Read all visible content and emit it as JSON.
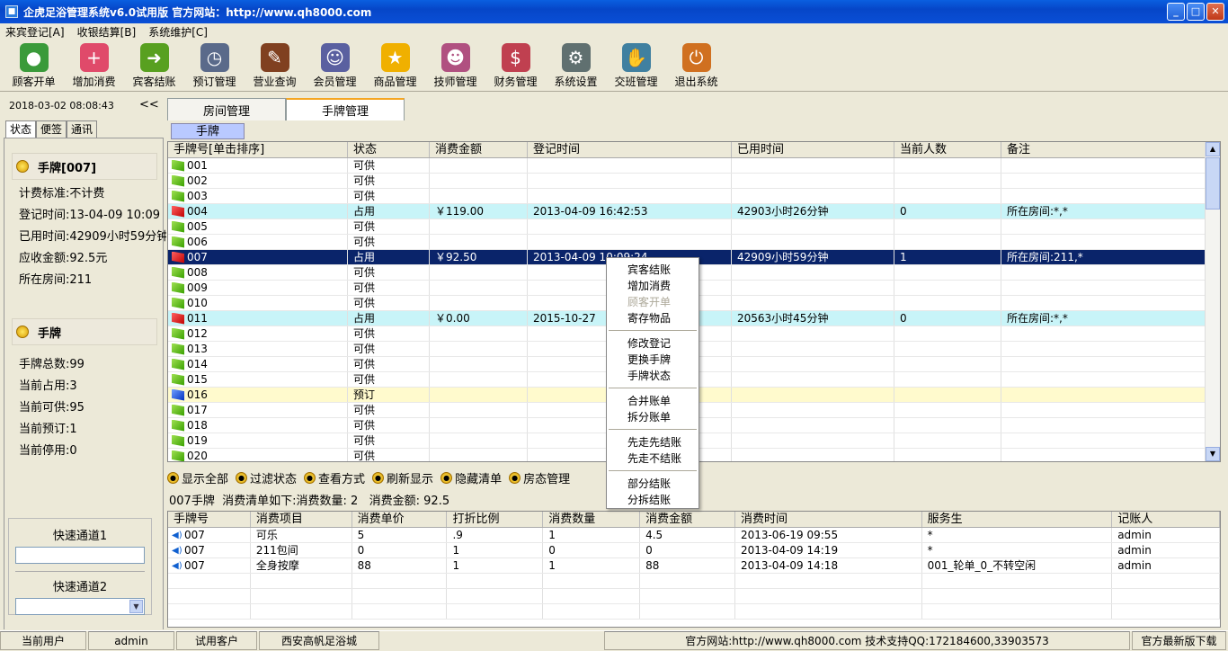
{
  "window": {
    "title": "企虎足浴管理系统v6.0试用版 官方网站：http://www.qh8000.com"
  },
  "menu": [
    "来宾登记[A]",
    "收银结算[B]",
    "系统维护[C]"
  ],
  "toolbar": [
    {
      "label": "顾客开单",
      "icon": "customer-icon",
      "color": "#3a9a3a"
    },
    {
      "label": "增加消费",
      "icon": "add-icon",
      "color": "#e04a6a"
    },
    {
      "label": "宾客结账",
      "icon": "checkout-icon",
      "color": "#58a020"
    },
    {
      "label": "预订管理",
      "icon": "clock-icon",
      "color": "#5a6a8a"
    },
    {
      "label": "营业查询",
      "icon": "query-icon",
      "color": "#804020"
    },
    {
      "label": "会员管理",
      "icon": "members-icon",
      "color": "#5a60a0"
    },
    {
      "label": "商品管理",
      "icon": "star-icon",
      "color": "#f0b000"
    },
    {
      "label": "技师管理",
      "icon": "staff-icon",
      "color": "#b05080"
    },
    {
      "label": "财务管理",
      "icon": "finance-icon",
      "color": "#c04050"
    },
    {
      "label": "系统设置",
      "icon": "settings-icon",
      "color": "#607070"
    },
    {
      "label": "交班管理",
      "icon": "handshake-icon",
      "color": "#4080a0"
    },
    {
      "label": "退出系统",
      "icon": "exit-icon",
      "color": "#d07020"
    }
  ],
  "left": {
    "datetime": "2018-03-02 08:08:43",
    "collapse": "<<",
    "tabs": [
      "状态",
      "便签",
      "通讯"
    ],
    "card_head": "手牌[007]",
    "card_info": [
      "计费标准:不计费",
      "登记时间:13-04-09 10:09",
      "已用时间:42909小时59分钟",
      "应收金额:92.5元",
      "所在房间:211"
    ],
    "stat_head": "手牌",
    "stat_info": [
      "手牌总数:99",
      "当前占用:3",
      "当前可供:95",
      "当前预订:1",
      "当前停用:0"
    ],
    "quick1": "快速通道1",
    "quick2": "快速通道2"
  },
  "tabs": [
    "房间管理",
    "手牌管理"
  ],
  "subtab": "手牌",
  "grid": {
    "headers": [
      "手牌号[单击排序]",
      "状态",
      "消费金额",
      "登记时间",
      "已用时间",
      "当前人数",
      "备注"
    ],
    "rows": [
      {
        "no": "001",
        "status": "可供",
        "amount": "",
        "time": "",
        "used": "",
        "people": "",
        "note": "",
        "type": "free"
      },
      {
        "no": "002",
        "status": "可供",
        "amount": "",
        "time": "",
        "used": "",
        "people": "",
        "note": "",
        "type": "free"
      },
      {
        "no": "003",
        "status": "可供",
        "amount": "",
        "time": "",
        "used": "",
        "people": "",
        "note": "",
        "type": "free"
      },
      {
        "no": "004",
        "status": "占用",
        "amount": "￥119.00",
        "time": "2013-04-09 16:42:53",
        "used": "42903小时26分钟",
        "people": "0",
        "note": "所在房间:*,*",
        "type": "occ"
      },
      {
        "no": "005",
        "status": "可供",
        "amount": "",
        "time": "",
        "used": "",
        "people": "",
        "note": "",
        "type": "free"
      },
      {
        "no": "006",
        "status": "可供",
        "amount": "",
        "time": "",
        "used": "",
        "people": "",
        "note": "",
        "type": "free"
      },
      {
        "no": "007",
        "status": "占用",
        "amount": "￥92.50",
        "time": "2013-04-09 10:09:24",
        "used": "42909小时59分钟",
        "people": "1",
        "note": "所在房间:211,*",
        "type": "sel"
      },
      {
        "no": "008",
        "status": "可供",
        "amount": "",
        "time": "",
        "used": "",
        "people": "",
        "note": "",
        "type": "free"
      },
      {
        "no": "009",
        "status": "可供",
        "amount": "",
        "time": "",
        "used": "",
        "people": "",
        "note": "",
        "type": "free"
      },
      {
        "no": "010",
        "status": "可供",
        "amount": "",
        "time": "",
        "used": "",
        "people": "",
        "note": "",
        "type": "free"
      },
      {
        "no": "011",
        "status": "占用",
        "amount": "￥0.00",
        "time": "2015-10-27",
        "used": "20563小时45分钟",
        "people": "0",
        "note": "所在房间:*,*",
        "type": "occ"
      },
      {
        "no": "012",
        "status": "可供",
        "amount": "",
        "time": "",
        "used": "",
        "people": "",
        "note": "",
        "type": "free"
      },
      {
        "no": "013",
        "status": "可供",
        "amount": "",
        "time": "",
        "used": "",
        "people": "",
        "note": "",
        "type": "free"
      },
      {
        "no": "014",
        "status": "可供",
        "amount": "",
        "time": "",
        "used": "",
        "people": "",
        "note": "",
        "type": "free"
      },
      {
        "no": "015",
        "status": "可供",
        "amount": "",
        "time": "",
        "used": "",
        "people": "",
        "note": "",
        "type": "free"
      },
      {
        "no": "016",
        "status": "预订",
        "amount": "",
        "time": "",
        "used": "",
        "people": "",
        "note": "",
        "type": "res"
      },
      {
        "no": "017",
        "status": "可供",
        "amount": "",
        "time": "",
        "used": "",
        "people": "",
        "note": "",
        "type": "free"
      },
      {
        "no": "018",
        "status": "可供",
        "amount": "",
        "time": "",
        "used": "",
        "people": "",
        "note": "",
        "type": "free"
      },
      {
        "no": "019",
        "status": "可供",
        "amount": "",
        "time": "",
        "used": "",
        "people": "",
        "note": "",
        "type": "free"
      },
      {
        "no": "020",
        "status": "可供",
        "amount": "",
        "time": "",
        "used": "",
        "people": "",
        "note": "",
        "type": "free"
      }
    ]
  },
  "actions": [
    "显示全部",
    "过滤状态",
    "查看方式",
    "刷新显示",
    "隐藏清单",
    "房态管理"
  ],
  "summary": "007手牌  消费清单如下:消费数量: 2   消费金额: 92.5",
  "detail": {
    "headers": [
      "手牌号",
      "消费项目",
      "消费单价",
      "打折比例",
      "消费数量",
      "消费金额",
      "消费时间",
      "服务生",
      "记账人"
    ],
    "rows": [
      [
        "007",
        "可乐",
        "5",
        ".9",
        "1",
        "4.5",
        "2013-06-19 09:55",
        "*",
        "admin"
      ],
      [
        "007",
        "211包间",
        "0",
        "1",
        "0",
        "0",
        "2013-04-09 14:19",
        "*",
        "admin"
      ],
      [
        "007",
        "全身按摩",
        "88",
        "1",
        "1",
        "88",
        "2013-04-09 14:18",
        "001_轮单_0_不转空闲",
        "admin"
      ]
    ]
  },
  "context_menu": [
    [
      {
        "label": "宾客结账"
      },
      {
        "label": "增加消费"
      },
      {
        "label": "顾客开单",
        "disabled": true
      },
      {
        "label": "寄存物品"
      }
    ],
    [
      {
        "label": "修改登记"
      },
      {
        "label": "更换手牌"
      },
      {
        "label": "手牌状态"
      }
    ],
    [
      {
        "label": "合并账单"
      },
      {
        "label": "拆分账单"
      }
    ],
    [
      {
        "label": "先走先结账"
      },
      {
        "label": "先走不结账"
      }
    ],
    [
      {
        "label": "部分结账"
      },
      {
        "label": "分拆结账"
      }
    ]
  ],
  "status": [
    "当前用户",
    "admin",
    "试用客户",
    "西安高帆足浴城",
    "官方网站:http://www.qh8000.com 技术支持QQ:172184600,33903573",
    "官方最新版下载"
  ]
}
